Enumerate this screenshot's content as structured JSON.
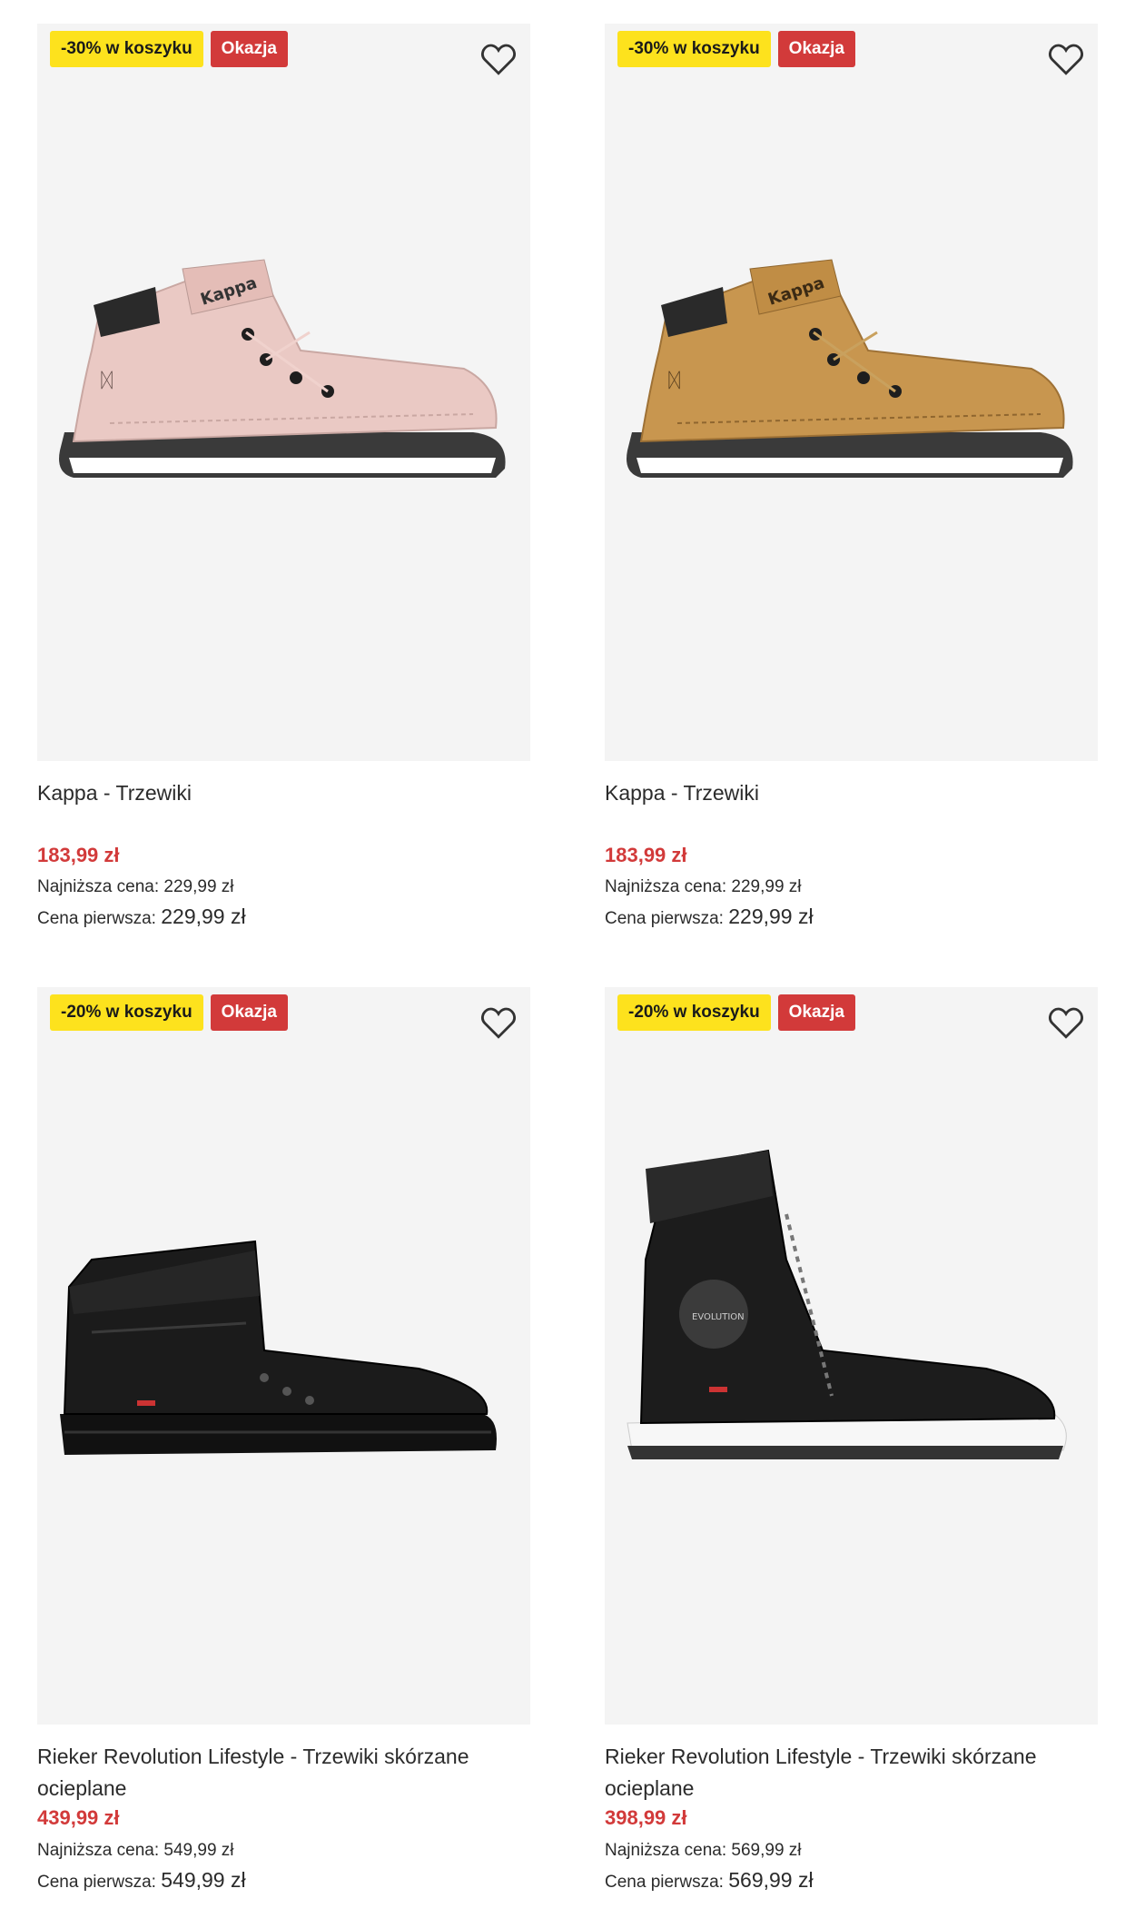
{
  "products": [
    {
      "promo": "-30% w koszyku",
      "deal": "Okazja",
      "title": "Kappa - Trzewiki",
      "price": "183,99 zł",
      "lowest_label": "Najniższa cena:",
      "lowest_value": "229,99 zł",
      "first_label": "Cena pierwsza:",
      "first_value": "229,99 zł",
      "shoe_brand": "Kappa",
      "shoe_color": "#eac9c4"
    },
    {
      "promo": "-30% w koszyku",
      "deal": "Okazja",
      "title": "Kappa - Trzewiki",
      "price": "183,99 zł",
      "lowest_label": "Najniższa cena:",
      "lowest_value": "229,99 zł",
      "first_label": "Cena pierwsza:",
      "first_value": "229,99 zł",
      "shoe_brand": "Kappa",
      "shoe_color": "#c8964f"
    },
    {
      "promo": "-20% w koszyku",
      "deal": "Okazja",
      "title": "Rieker Revolution Lifestyle - Trzewiki skórzane ocieplane",
      "price": "439,99 zł",
      "lowest_label": "Najniższa cena:",
      "lowest_value": "549,99 zł",
      "first_label": "Cena pierwsza:",
      "first_value": "549,99 zł",
      "shoe_color": "#1b1b1b"
    },
    {
      "promo": "-20% w koszyku",
      "deal": "Okazja",
      "title": "Rieker Revolution Lifestyle - Trzewiki skórzane ocieplane",
      "price": "398,99 zł",
      "lowest_label": "Najniższa cena:",
      "lowest_value": "569,99 zł",
      "first_label": "Cena pierwsza:",
      "first_value": "569,99 zł",
      "shoe_logo": "EVOLUTION",
      "shoe_color": "#1c1c1c"
    }
  ]
}
